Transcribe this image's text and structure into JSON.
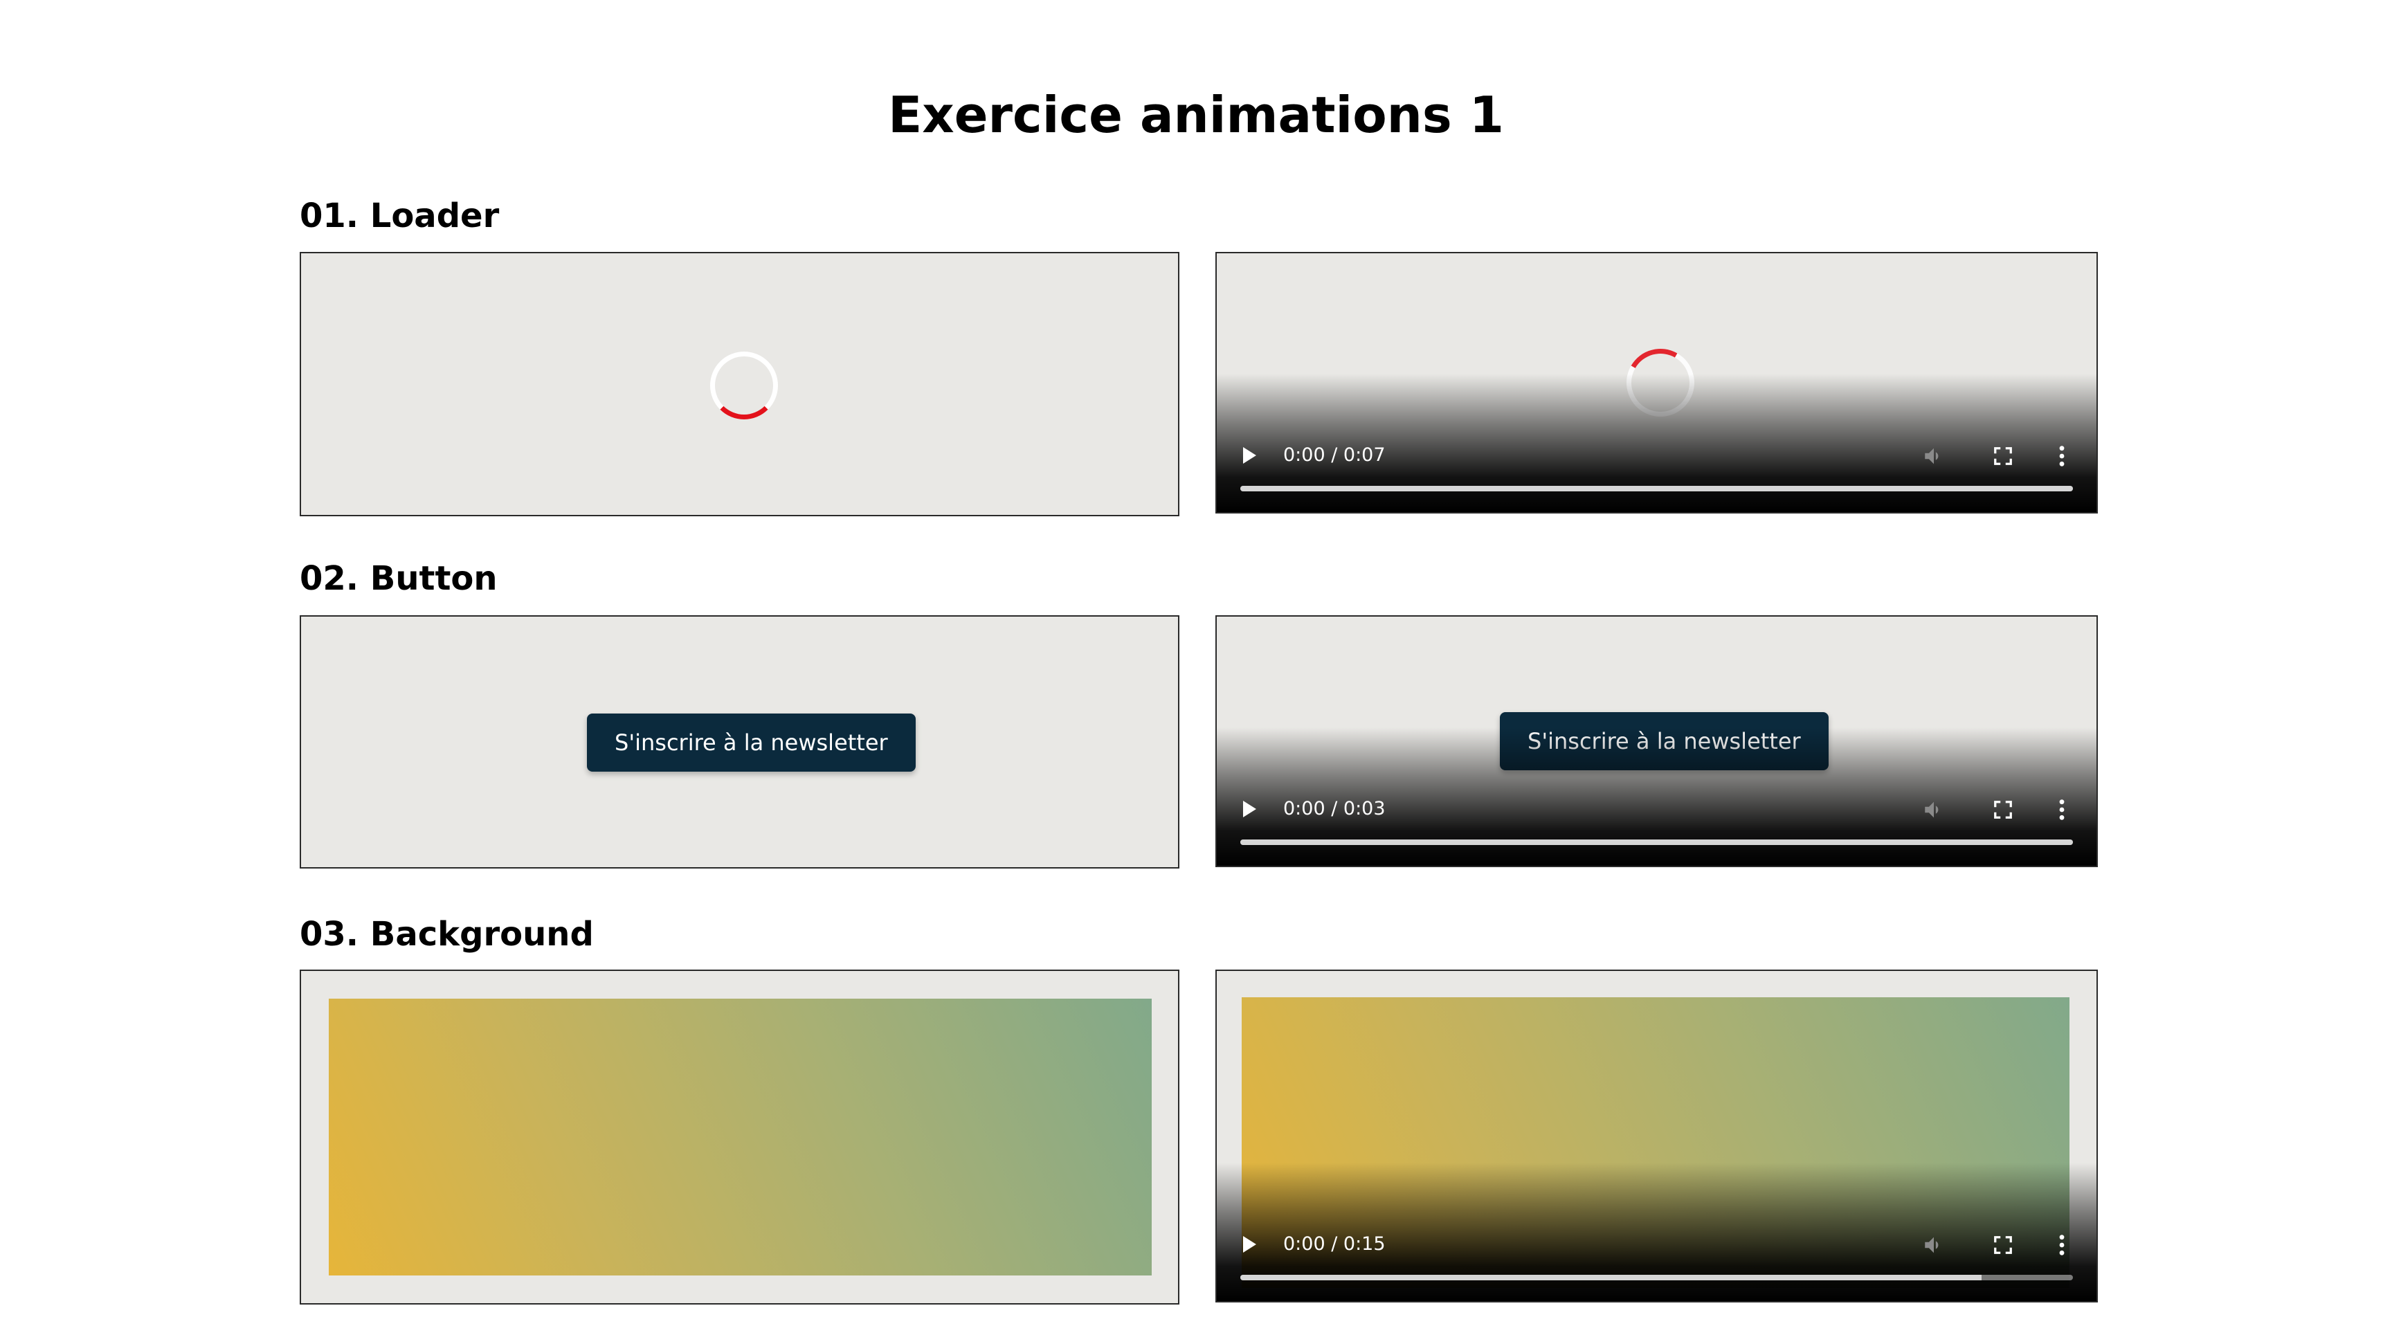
{
  "page": {
    "title": "Exercice animations 1"
  },
  "sections": [
    {
      "title": "01. Loader",
      "video": {
        "time": "0:00 / 0:07",
        "buffered": 1.0
      }
    },
    {
      "title": "02. Button",
      "button_label": "S'inscrire à la newsletter",
      "video": {
        "time": "0:00 / 0:03",
        "buffered": 1.0
      }
    },
    {
      "title": "03. Background",
      "video": {
        "time": "0:00 / 0:15",
        "buffered": 0.89
      }
    }
  ],
  "colors": {
    "loader_accent": "#e3121b",
    "button_bg": "#0b2a3d",
    "gradient_start": "#e6b53a",
    "gradient_end": "#82a98a",
    "demo_bg": "#e9e8e5"
  },
  "icons": {
    "play": "play-icon",
    "volume": "volume-muted-icon",
    "fullscreen": "fullscreen-icon",
    "more": "more-vertical-icon"
  }
}
